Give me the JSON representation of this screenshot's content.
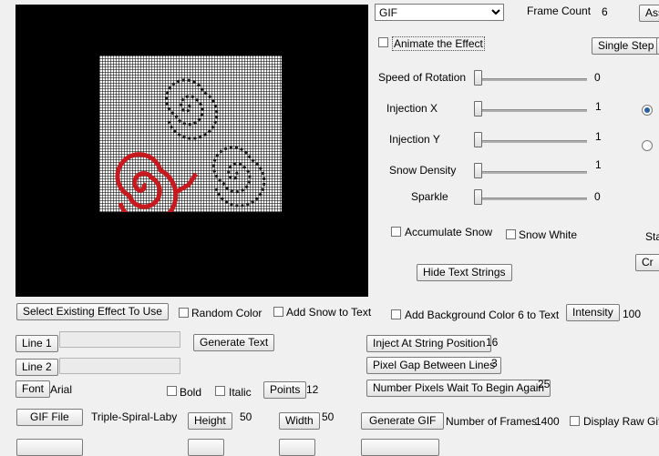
{
  "preview": {
    "alt": "triple spiral labyrinth preview"
  },
  "format_select": {
    "value": "GIF"
  },
  "frame_count": {
    "label": "Frame Count",
    "value": "6"
  },
  "top_right_button": "Ass",
  "animate_effect": {
    "label": "Animate the Effect",
    "checked": false
  },
  "single_step_button": "Single Step",
  "sliders": [
    {
      "label": "Speed of Rotation",
      "value": "0"
    },
    {
      "label": "Injection X",
      "value": "1"
    },
    {
      "label": "Injection Y",
      "value": "1"
    },
    {
      "label": "Snow Density",
      "value": "1"
    },
    {
      "label": "Sparkle",
      "value": "0"
    }
  ],
  "accumulate_snow": {
    "label": "Accumulate Snow",
    "checked": false
  },
  "snow_white": {
    "label": "Snow White",
    "checked": false
  },
  "right_cut_label": "Sta",
  "right_cut_button": "Cr",
  "hide_text_strings_button": "Hide Text Strings",
  "select_existing_effect_button": "Select Existing Effect To Use",
  "random_color": {
    "label": "Random Color",
    "checked": false
  },
  "add_snow_to_text": {
    "label": "Add Snow to Text",
    "checked": false
  },
  "add_background_color": {
    "label": "Add Background Color 6 to Text",
    "checked": false
  },
  "intensity": {
    "button": "Intensity",
    "value": "100"
  },
  "line1": {
    "button": "Line 1",
    "value": ""
  },
  "line2": {
    "button": "Line 2",
    "value": ""
  },
  "generate_text_button": "Generate Text",
  "inject_at_string_position": {
    "button": "Inject At String Position",
    "value": "16"
  },
  "pixel_gap_between_lines": {
    "button": "Pixel Gap Between Lines",
    "value": "3"
  },
  "number_pixels_wait": {
    "button": "Number Pixels Wait To Begin Again",
    "value": "25"
  },
  "font": {
    "button": "Font",
    "value": "Arial"
  },
  "bold": {
    "label": "Bold",
    "checked": false
  },
  "italic": {
    "label": "Italic",
    "checked": false
  },
  "points": {
    "button": "Points",
    "value": "12"
  },
  "gif_file": {
    "button": "GIF File",
    "value": "Triple-Spiral-Labyrin"
  },
  "height": {
    "button": "Height",
    "value": "50"
  },
  "width": {
    "button": "Width",
    "value": "50"
  },
  "generate_gif_button": "Generate GIF",
  "number_of_frames": {
    "label": "Number of Frames",
    "value": "1400"
  },
  "display_raw_gif": {
    "label": "Display Raw Gif",
    "checked": false
  },
  "colors": {
    "spiral_red": "#c8191e",
    "grid_white": "#ffffff",
    "canvas_black": "#000000"
  }
}
